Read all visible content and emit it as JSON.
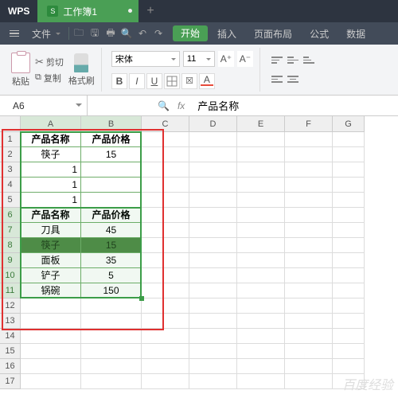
{
  "title": {
    "wps": "WPS",
    "tab": "工作簿1",
    "tabIcon": "S"
  },
  "menu": {
    "fileLabel": "文件",
    "tabs": [
      "开始",
      "插入",
      "页面布局",
      "公式",
      "数据"
    ],
    "activeIndex": 0
  },
  "ribbon": {
    "cut": "剪切",
    "copy": "复制",
    "paste": "粘贴",
    "formatPainter": "格式刷",
    "fontName": "宋体",
    "fontSize": "11",
    "bold": "B",
    "italic": "I",
    "underline": "U",
    "increaseFont": "A⁺",
    "decreaseFont": "A⁻",
    "fontColorLetter": "A"
  },
  "nameBox": "A6",
  "formula": "产品名称",
  "colWidths": {
    "A": 76,
    "B": 76,
    "C": 60,
    "D": 60,
    "E": 60,
    "F": 60,
    "G": 40
  },
  "cols": [
    "A",
    "B",
    "C",
    "D",
    "E",
    "F",
    "G"
  ],
  "rows": 17,
  "cells": {
    "A1": "产品名称",
    "B1": "产品价格",
    "A2": "筷子",
    "B2": "15",
    "A3": "1",
    "A4": "1",
    "A5": "1",
    "A6": "产品名称",
    "B6": "产品价格",
    "A7": "刀具",
    "B7": "45",
    "A8": "筷子",
    "B8": "15",
    "A9": "面板",
    "B9": "35",
    "A10": "铲子",
    "B10": "5",
    "A11": "锅碗",
    "B11": "150"
  },
  "styles": {
    "boldCells": [
      "A1",
      "B1",
      "A6",
      "B6"
    ],
    "rightCells": [
      "A3",
      "A4",
      "A5"
    ],
    "highlightRow": 8,
    "greenRange": {
      "r1": 1,
      "r2": 11,
      "c1": "A",
      "c2": "B"
    }
  },
  "selection": {
    "r1": 6,
    "r2": 11,
    "c1": "A",
    "c2": "B"
  },
  "watermark": "百度经验"
}
